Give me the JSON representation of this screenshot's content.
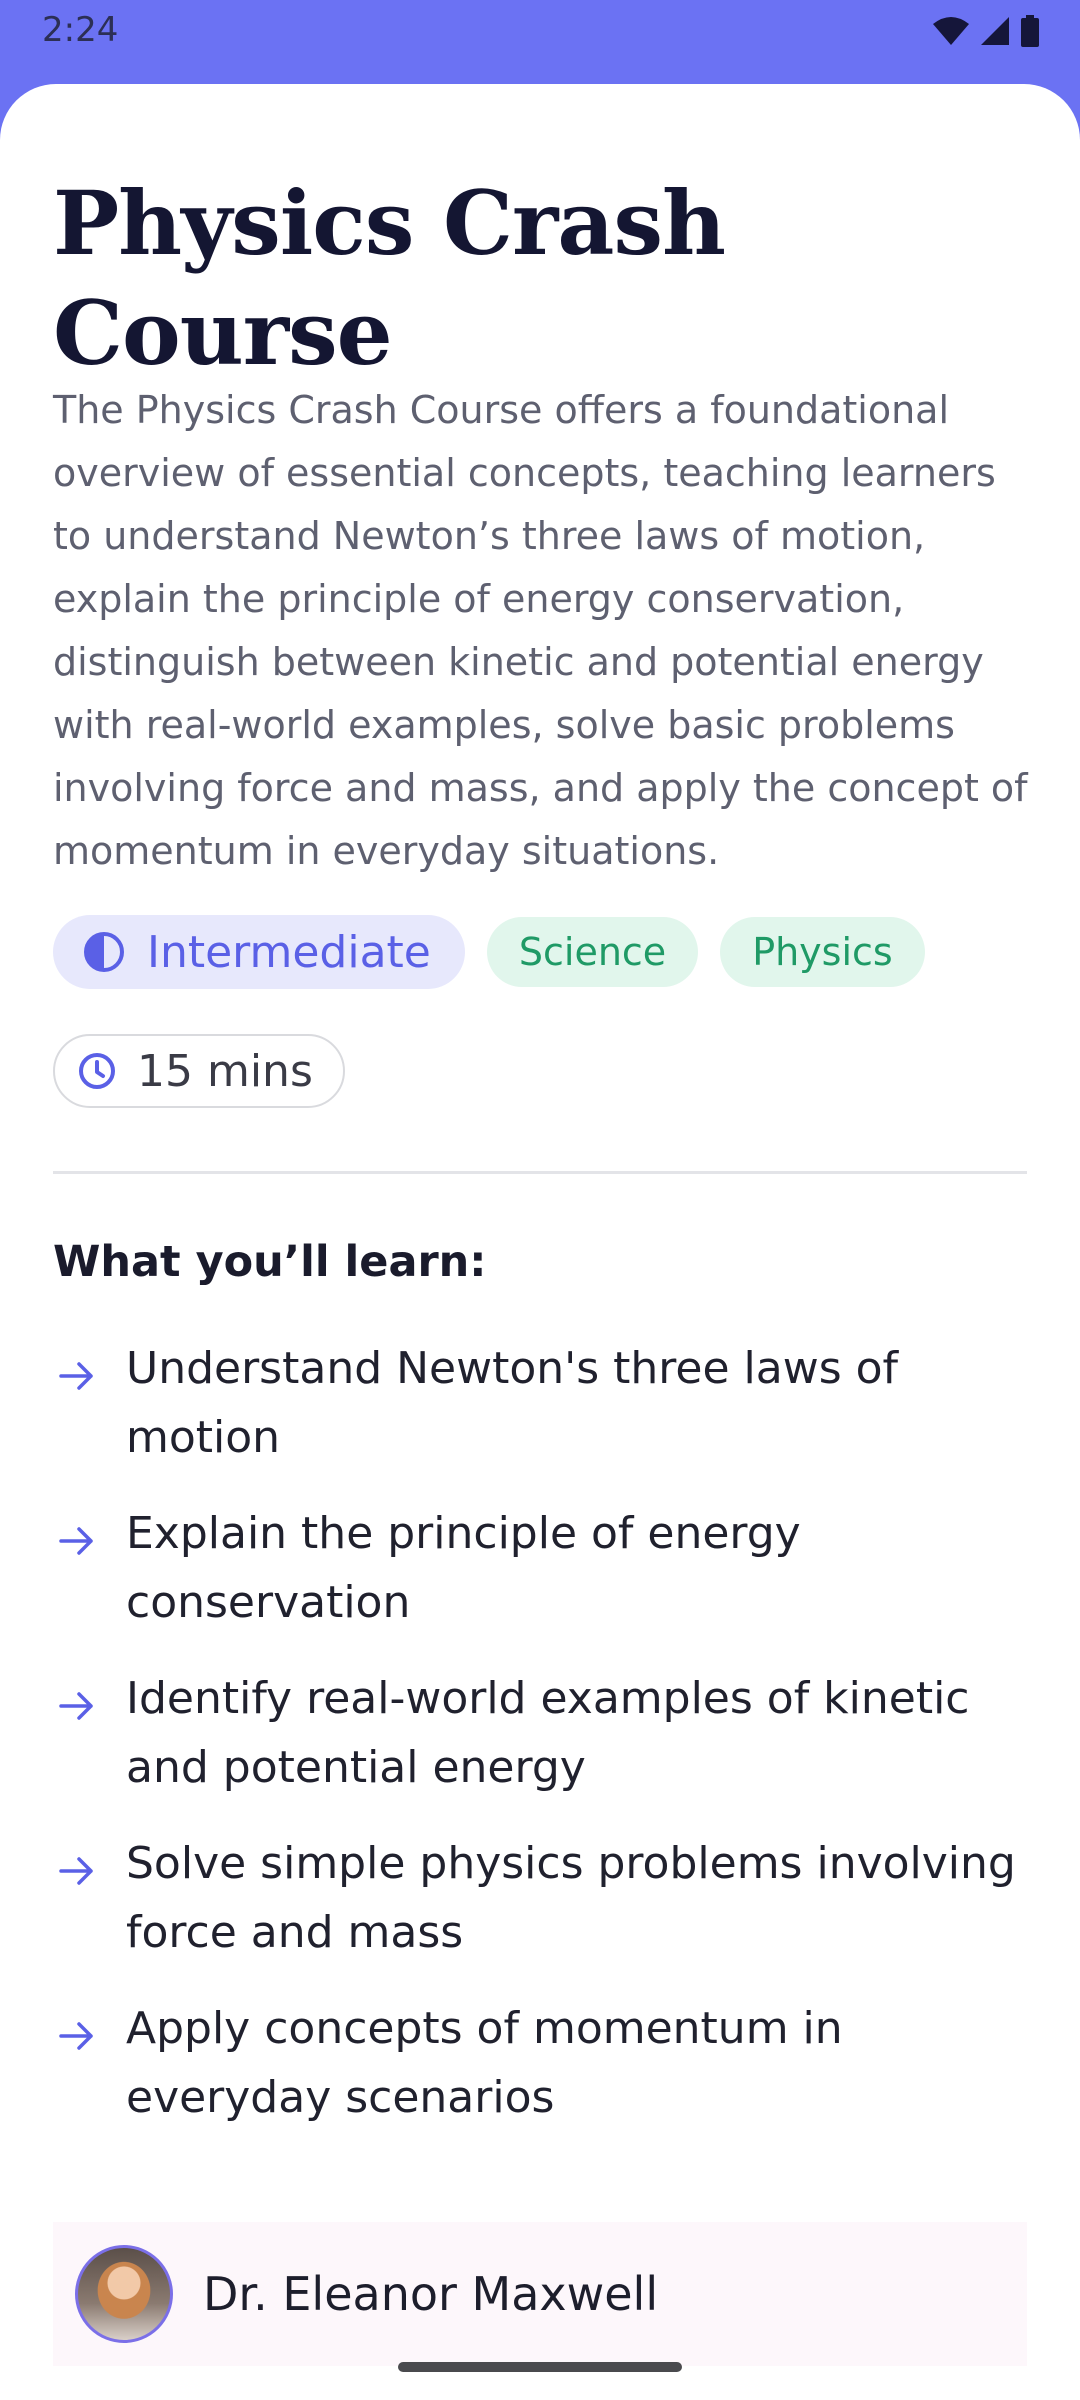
{
  "status_bar": {
    "time": "2:24"
  },
  "course": {
    "title": "Physics Crash Course",
    "description": "The Physics Crash Course offers a foundational overview of essential concepts, teaching learners to understand Newton’s three laws of motion, explain the principle of energy conservation, distinguish between kinetic and potential energy with real-world examples, solve basic problems involving force and mass, and apply the concept of momentum in everyday situations.",
    "level": "Intermediate",
    "tags": [
      "Science",
      "Physics"
    ],
    "duration": "15 mins"
  },
  "learn": {
    "heading": "What you’ll learn:",
    "items": [
      "Understand Newton's three laws of motion",
      "Explain the principle of energy conservation",
      "Identify real-world examples of kinetic and potential energy",
      "Solve simple physics problems involving force and mass",
      "Apply concepts of momentum in everyday scenarios"
    ]
  },
  "instructor": {
    "name": "Dr. Eleanor Maxwell"
  },
  "colors": {
    "accent": "#6b72f3",
    "tag_green": "#1f9a66",
    "tag_bg": "#e1f6ec"
  }
}
